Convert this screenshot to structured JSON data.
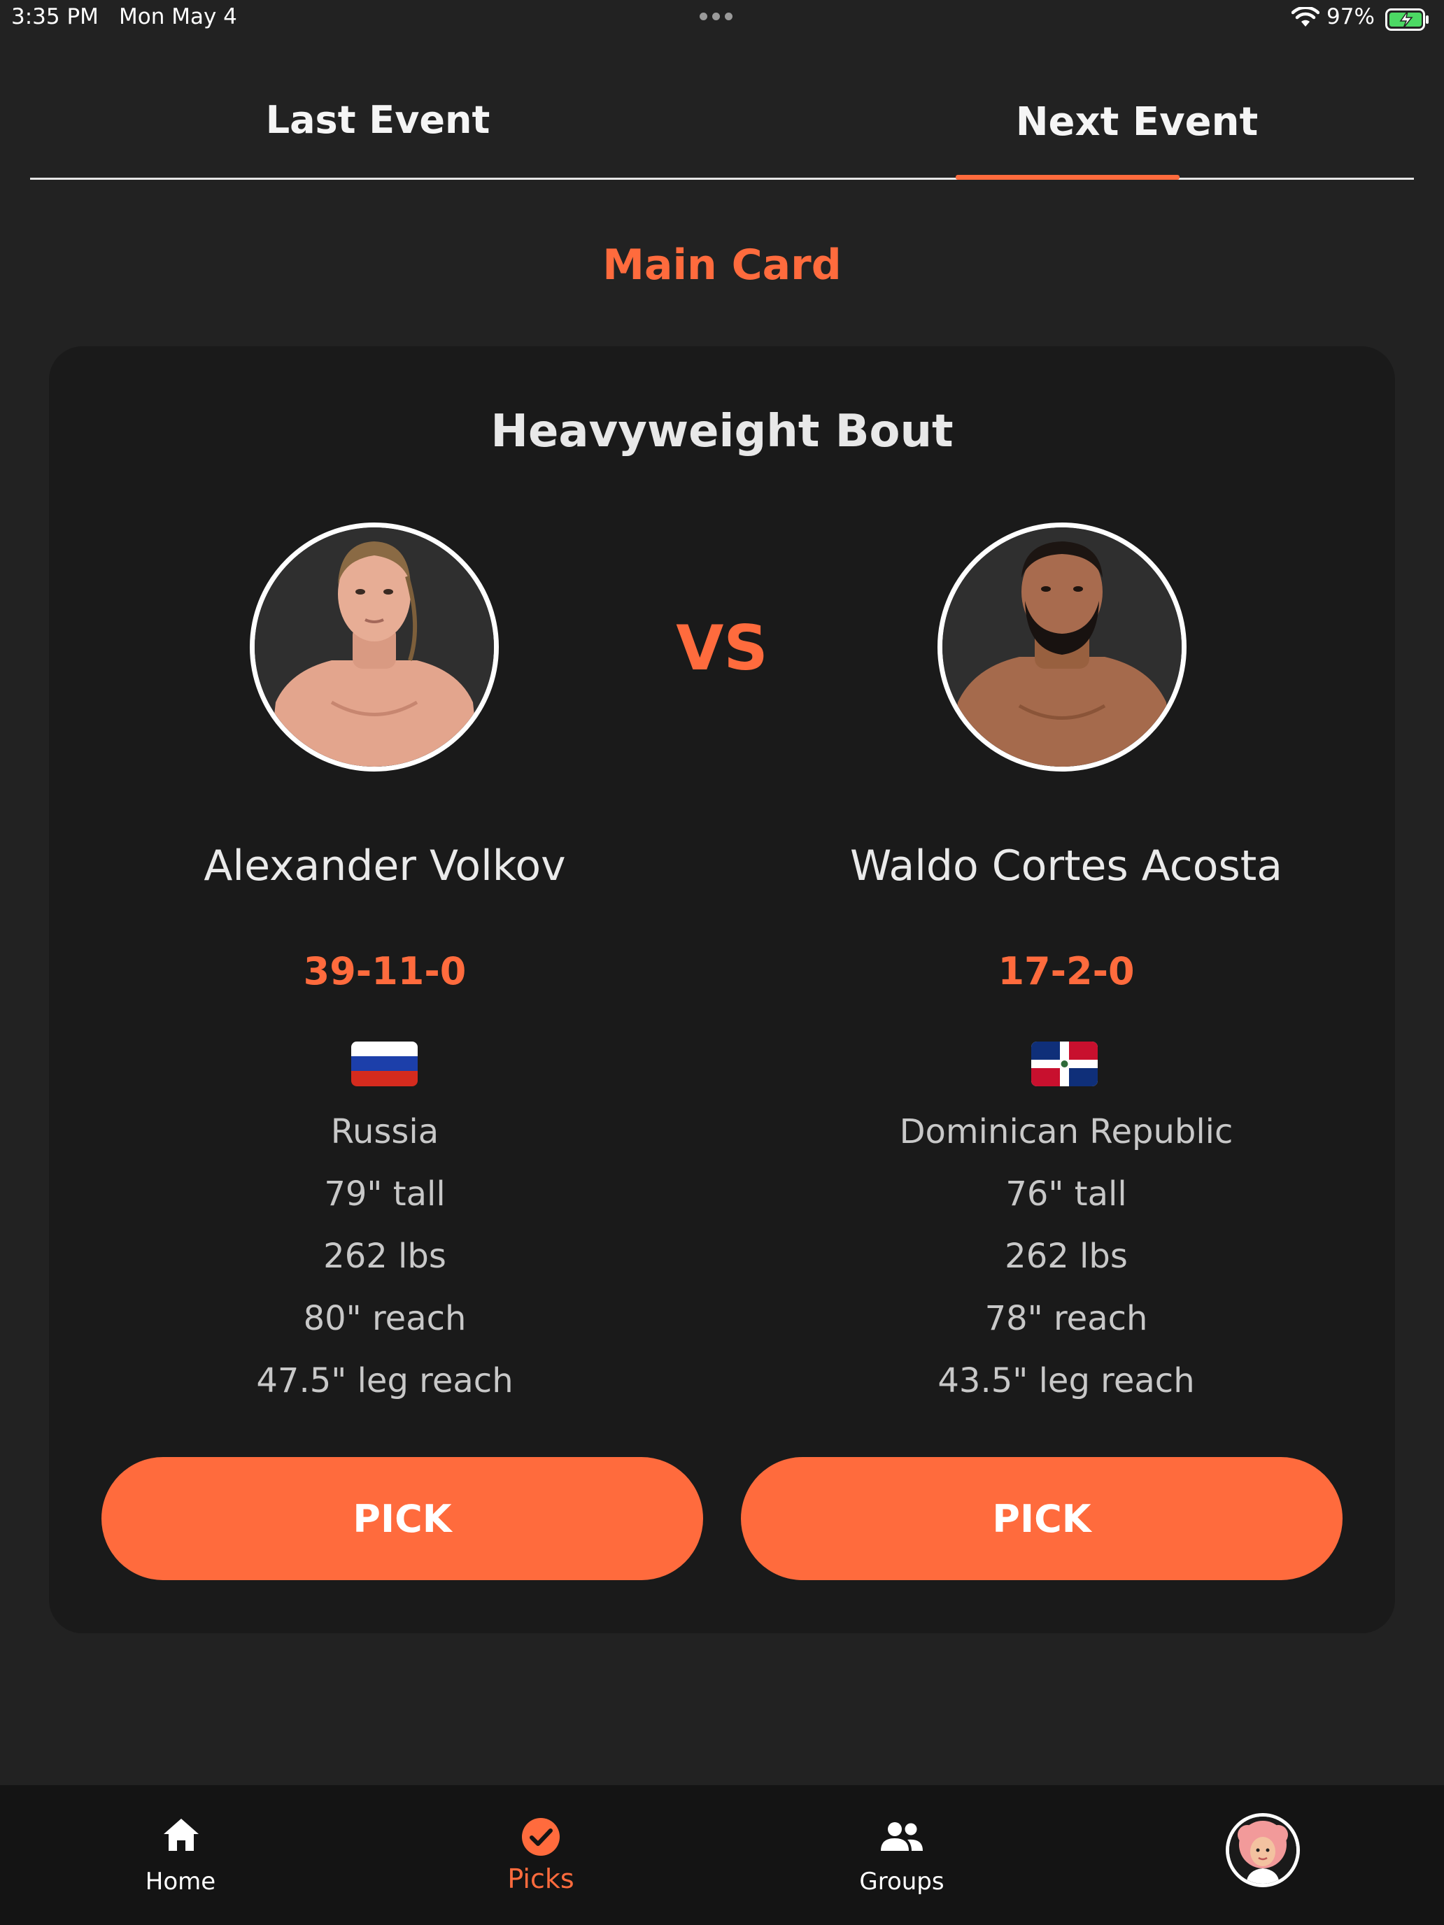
{
  "status_bar": {
    "time": "3:35 PM",
    "date": "Mon May 4",
    "battery": "97%"
  },
  "tabs": [
    {
      "label": "Last Event",
      "active": false
    },
    {
      "label": "Next Event",
      "active": true
    }
  ],
  "section_title": "Main Card",
  "bout": {
    "title": "Heavyweight Bout",
    "vs_label": "VS",
    "fighters": [
      {
        "name": "Alexander Volkov",
        "record": "39-11-0",
        "flag": "russia-flag",
        "country": "Russia",
        "height": "79\" tall",
        "weight": "262 lbs",
        "reach": "80\" reach",
        "leg_reach": "47.5\" leg reach",
        "pick_label": "PICK"
      },
      {
        "name": "Waldo Cortes Acosta",
        "record": "17-2-0",
        "flag": "dominican-republic-flag",
        "country": "Dominican Republic",
        "height": "76\" tall",
        "weight": "262 lbs",
        "reach": "78\" reach",
        "leg_reach": "43.5\" leg reach",
        "pick_label": "PICK"
      }
    ]
  },
  "bottom_nav": [
    {
      "label": "Home",
      "icon": "home-icon",
      "active": false
    },
    {
      "label": "Picks",
      "icon": "check-circle-icon",
      "active": true
    },
    {
      "label": "Groups",
      "icon": "groups-icon",
      "active": false
    },
    {
      "label": "",
      "icon": "profile-avatar",
      "active": false
    }
  ],
  "colors": {
    "accent": "#ff6b3d",
    "background": "#222222",
    "card": "#1a1a1a",
    "nav": "#141414"
  }
}
